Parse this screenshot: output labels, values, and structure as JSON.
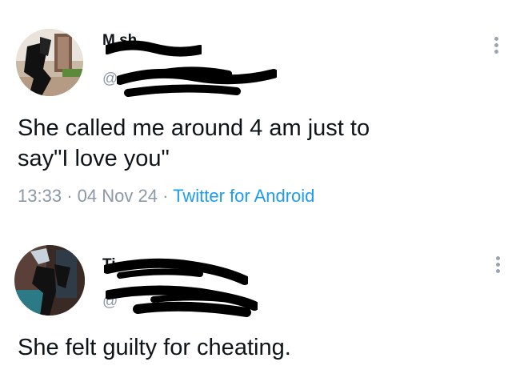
{
  "tweets": [
    {
      "name_visible": "M sh",
      "handle_visible": "@",
      "text": "She called me around 4 am just to\nsay\"I love you\"",
      "time": "13:33",
      "sep1": "·",
      "date": "04 Nov 24",
      "sep2": "·",
      "source": "Twitter for Android",
      "menu_icon": "more-vertical-icon"
    },
    {
      "name_visible": "Ti",
      "handle_visible": "@",
      "text": "She felt guilty for cheating.",
      "menu_icon": "more-vertical-icon"
    }
  ],
  "colors": {
    "text": "#0f1419",
    "muted": "#8b98a5",
    "link": "#1d9bf0",
    "redaction": "#000000"
  }
}
